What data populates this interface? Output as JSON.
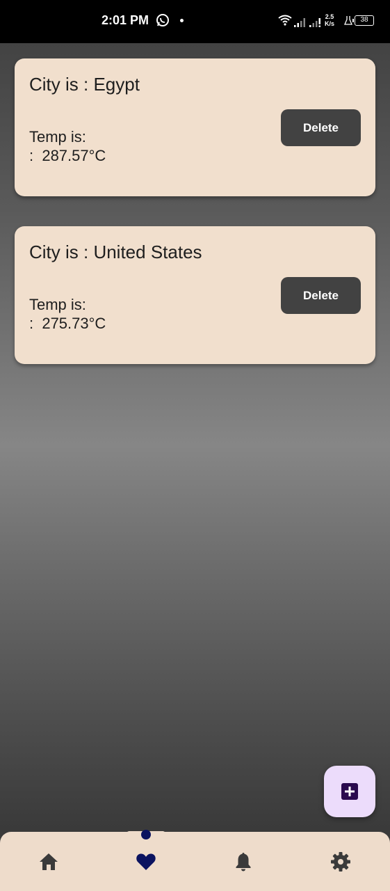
{
  "status_bar": {
    "time": "2:01 PM",
    "network_speed_value": "2.5",
    "network_speed_unit": "K/s",
    "battery_level": "38",
    "icons": [
      "whatsapp-icon",
      "wifi-icon",
      "signal-icon",
      "flask-icon",
      "battery-icon"
    ]
  },
  "cities": [
    {
      "title": "City is : Egypt",
      "temp_label": "Temp is:",
      "temp_value": ":  287.57°C",
      "delete_label": "Delete"
    },
    {
      "title": "City is : United States",
      "temp_label": "Temp is:",
      "temp_value": ":  275.73°C",
      "delete_label": "Delete"
    }
  ],
  "fab": {
    "icon": "add-box-icon"
  },
  "bottom_nav": {
    "items": [
      {
        "icon": "home-icon",
        "active": false
      },
      {
        "icon": "heart-icon",
        "active": true
      },
      {
        "icon": "bell-icon",
        "active": false
      },
      {
        "icon": "gear-icon",
        "active": false
      }
    ]
  },
  "colors": {
    "card_background": "#f1dfcd",
    "button_background": "#424242",
    "nav_background": "#eedccb",
    "nav_active": "#0b1360",
    "fab_background": "#ecdcfb",
    "fab_icon": "#2a0a4e"
  }
}
